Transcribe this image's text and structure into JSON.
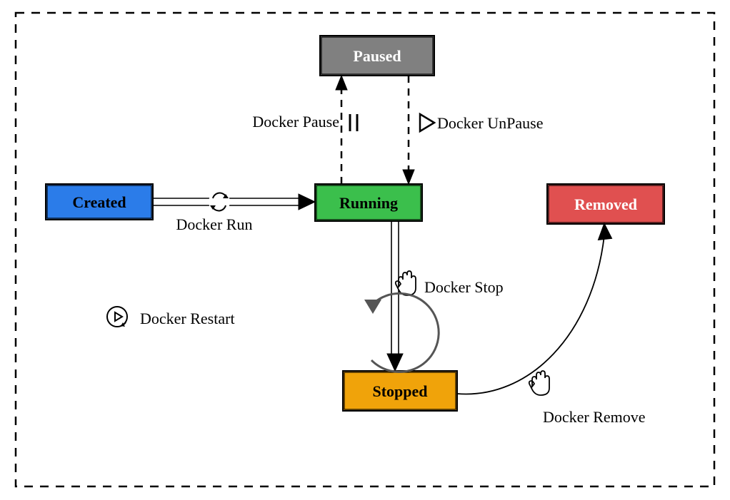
{
  "states": {
    "created": {
      "label": "Created",
      "color": "#2b7ce9"
    },
    "running": {
      "label": "Running",
      "color": "#3bbf4c"
    },
    "paused": {
      "label": "Paused",
      "color": "#808080"
    },
    "stopped": {
      "label": "Stopped",
      "color": "#f0a30a"
    },
    "removed": {
      "label": "Removed",
      "color": "#e05050"
    }
  },
  "transitions": {
    "run": {
      "label": "Docker Run",
      "from": "created",
      "to": "running"
    },
    "pause": {
      "label": "Docker Pause",
      "from": "running",
      "to": "paused"
    },
    "unpause": {
      "label": "Docker UnPause",
      "from": "paused",
      "to": "running"
    },
    "stop": {
      "label": "Docker Stop",
      "from": "running",
      "to": "stopped"
    },
    "restart": {
      "label": "Docker Restart",
      "from": "stopped",
      "to": "running"
    },
    "remove": {
      "label": "Docker Remove",
      "from": "stopped",
      "to": "removed"
    }
  }
}
